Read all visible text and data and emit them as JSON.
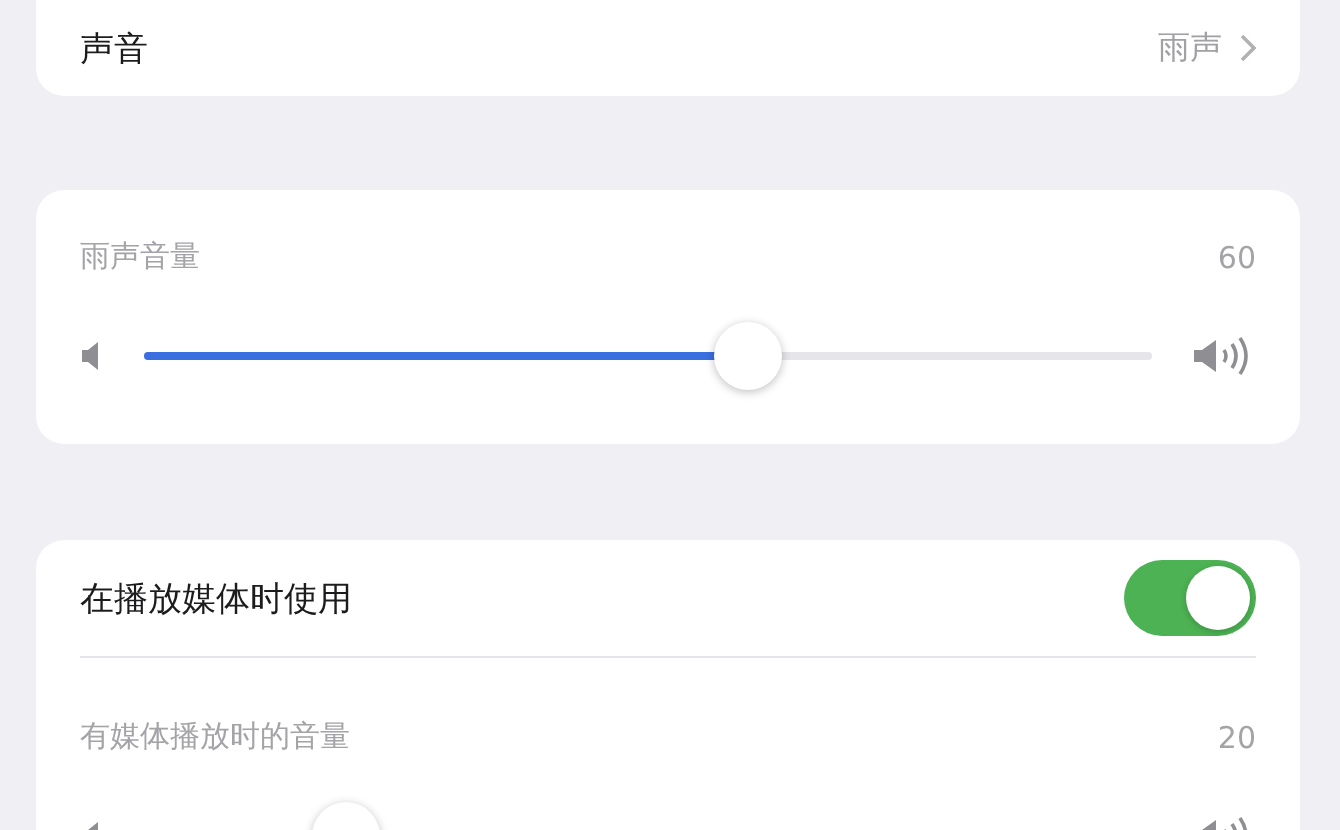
{
  "sound_row": {
    "label": "声音",
    "value": "雨声"
  },
  "rain_volume": {
    "label": "雨声音量",
    "reading": "60",
    "level": 0.6
  },
  "media_section": {
    "toggle": {
      "label": "在播放媒体时使用",
      "on": true
    },
    "volume": {
      "label": "有媒体播放时的音量",
      "reading": "20",
      "level": 0.2
    }
  }
}
